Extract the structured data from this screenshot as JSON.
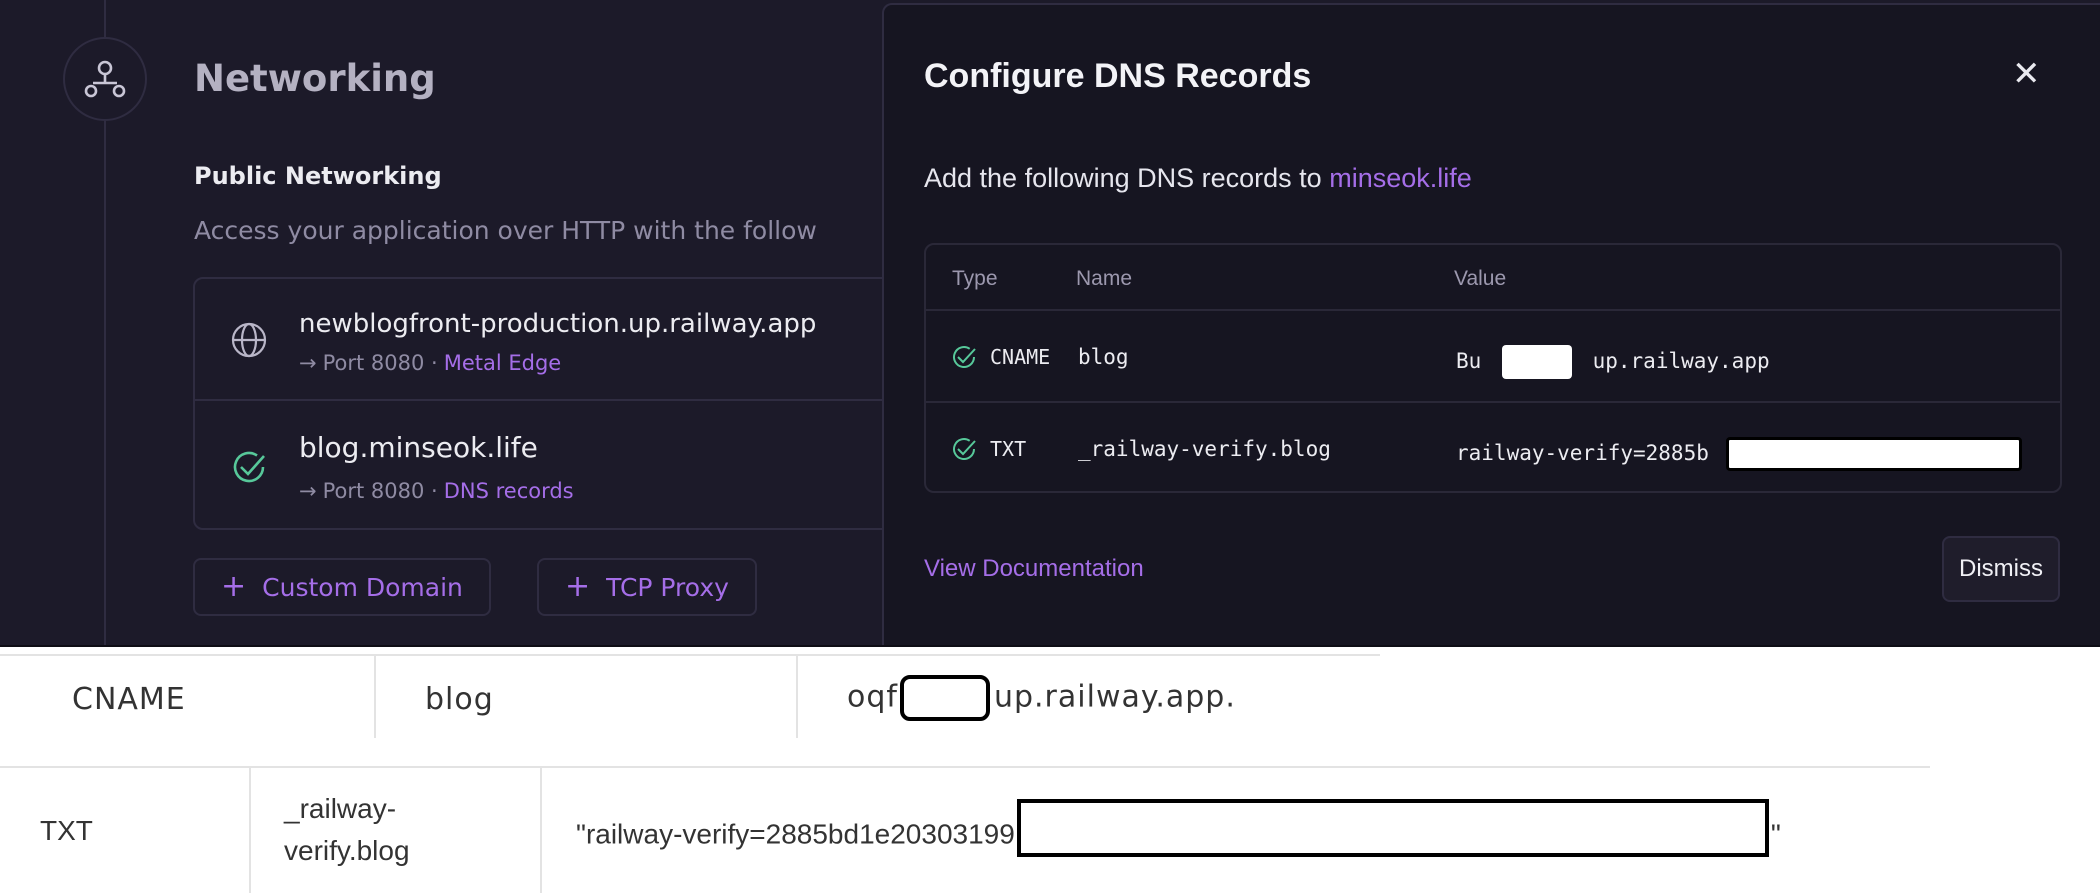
{
  "networking": {
    "title": "Networking",
    "public_title": "Public Networking",
    "public_desc": "Access your application over HTTP with the follow",
    "domains": [
      {
        "name": "newblogfront-production.up.railway.app",
        "port": "Port 8080 · ",
        "link": "Metal Edge"
      },
      {
        "name": "blog.minseok.life",
        "port": "Port 8080 · ",
        "link": "DNS records"
      }
    ],
    "buttons": [
      {
        "label": "Custom Domain"
      },
      {
        "label": "TCP Proxy"
      }
    ]
  },
  "dialog": {
    "title": "Configure DNS Records",
    "subtitle": "Add the following DNS records to ",
    "domain": "minseok.life",
    "table": {
      "headers": [
        "Type",
        "Name",
        "Value"
      ],
      "rows": [
        {
          "type": "CNAME",
          "name": "blog",
          "value_prefix": "Bu",
          "value_suffix": "up.railway.app"
        },
        {
          "type": "TXT",
          "name": "_railway-verify.blog",
          "value_prefix": "railway-verify=2885b",
          "value_suffix": ""
        }
      ]
    },
    "view_docs": "View Documentation",
    "dismiss": "Dismiss"
  },
  "provider_records": [
    {
      "type": "CNAME",
      "name": "blog",
      "value_prefix": "oqf",
      "value_suffix": "up.railway.app."
    },
    {
      "type": "TXT",
      "name_line1": "_railway-",
      "name_line2": "verify.blog",
      "value_prefix": "\"railway-verify=2885bd1e20303199",
      "value_suffix": "\""
    }
  ],
  "colors": {
    "background_dark": "#1c1a29",
    "dialog_bg": "#161521",
    "accent": "#a56ee8",
    "success": "#57c89a"
  }
}
